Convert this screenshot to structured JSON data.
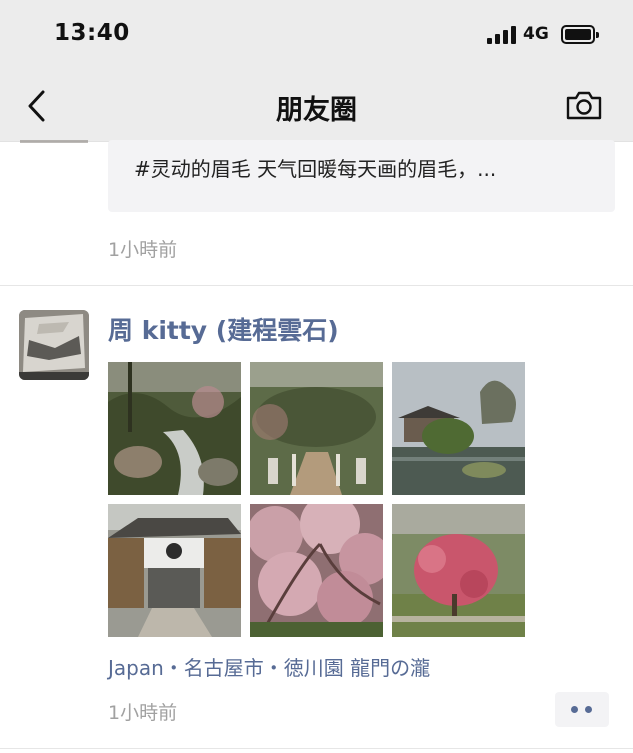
{
  "status_bar": {
    "time": "13:40",
    "network": "4G",
    "icons": [
      "signal-icon",
      "battery-icon"
    ]
  },
  "nav": {
    "title": "朋友圈",
    "back_icon": "chevron-left-icon",
    "camera_icon": "camera-icon"
  },
  "previous_post": {
    "text": "#灵动的眉毛 天气回暖每天画的眉毛，...",
    "time": "1小時前"
  },
  "post": {
    "author": "周 kitty (建程雲石)",
    "photos": [
      {
        "name": "garden-stream-photo"
      },
      {
        "name": "stone-bridge-photo"
      },
      {
        "name": "pond-pavilion-photo"
      },
      {
        "name": "gate-house-photo"
      },
      {
        "name": "pink-blossom-photo"
      },
      {
        "name": "red-blossom-tree-photo"
      }
    ],
    "location": "Japan・名古屋市・徳川園 龍門の瀧",
    "time": "1小時前",
    "more_icon": "more-dots-icon"
  },
  "colors": {
    "link_blue": "#576b95",
    "header_bg": "#ececec",
    "timestamp_gray": "#a1a1a1",
    "quote_bg": "#f3f3f5"
  }
}
